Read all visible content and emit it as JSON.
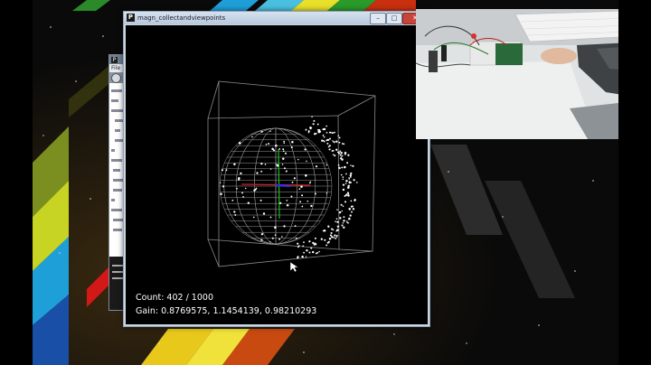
{
  "sketch_window": {
    "title": "magn_collectandviewpoints",
    "app_icon_letter": "P",
    "minimize_glyph": "–",
    "maximize_glyph": "□",
    "close_glyph": "✕"
  },
  "readout": {
    "count_label": "Count: 402 / 1000",
    "gain_label": "Gain: 0.8769575, 1.1454139, 0.98210293"
  },
  "points": {
    "collected": 402,
    "total": 1000
  },
  "gain": [
    0.8769575,
    1.1454139,
    0.98210293
  ],
  "background_window": {
    "app_icon_letter": "P",
    "menu_text": "File"
  },
  "axis_colors": {
    "x": "#d02020",
    "y": "#20c020",
    "z": "#3030e0"
  },
  "sphere_color": "#9a9a9a",
  "point_color": "#ffffff"
}
